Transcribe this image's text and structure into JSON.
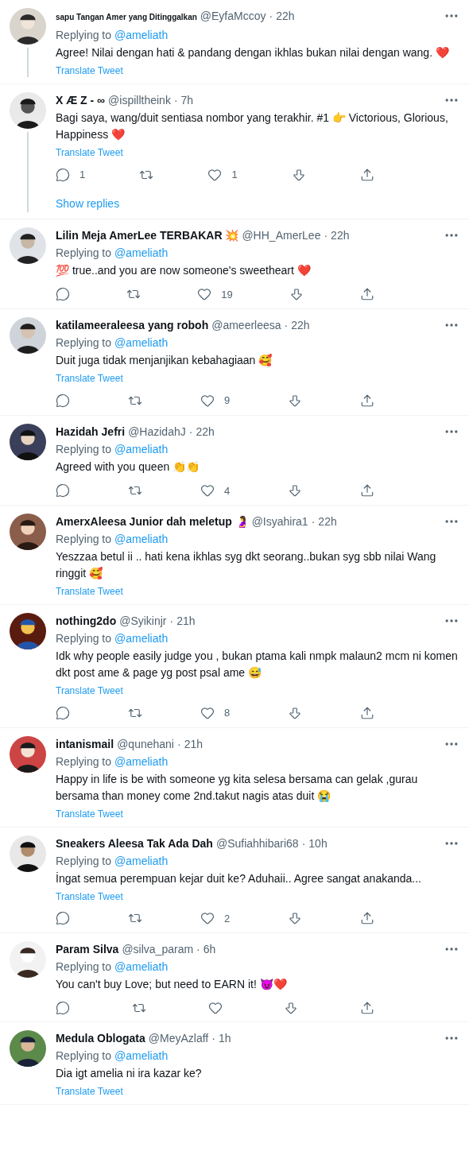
{
  "tweets": [
    {
      "name": "sapu Tangan Amer yang Ditinggalkan",
      "handle": "@EyfaMccoy",
      "separator": "·",
      "time": "22h",
      "replying_label": "Replying to",
      "replying_to": "@ameliath",
      "text": "Agree! Nilai dengan hati & pandang dengan ikhlas bukan nilai dengan wang. ❤️",
      "translate": "Translate Tweet",
      "thread": true,
      "actions": false
    },
    {
      "name": "X Æ Z - ∞",
      "handle": "@ispilltheink",
      "separator": "·",
      "time": "7h",
      "text": "Bagi saya, wang/duit sentiasa nombor yang terakhir. #1 👉 Victorious, Glorious, Happiness ❤️",
      "translate": "Translate Tweet",
      "actions": true,
      "reply_count": "1",
      "like_count": "1",
      "show_replies": "Show replies",
      "thread": true
    },
    {
      "name": "Lilin Meja AmerLee TERBAKAR 💥",
      "handle": "@HH_AmerLee",
      "separator": "·",
      "time": "22h",
      "replying_label": "Replying to",
      "replying_to": "@ameliath",
      "text": "💯 true..and you are now someone's sweetheart ❤️",
      "actions": true,
      "like_count": "19",
      "thread": false
    },
    {
      "name": "katilameeraleesa yang roboh",
      "handle": "@ameerleesa",
      "separator": "·",
      "time": "22h",
      "replying_label": "Replying to",
      "replying_to": "@ameliath",
      "text": "Duit juga tidak menjanjikan kebahagiaan 🥰",
      "translate": "Translate Tweet",
      "actions": true,
      "like_count": "9",
      "thread": false
    },
    {
      "name": "Hazidah Jefri",
      "handle": "@HazidahJ",
      "separator": "·",
      "time": "22h",
      "replying_label": "Replying to",
      "replying_to": "@ameliath",
      "text": "Agreed with you queen 👏👏",
      "actions": true,
      "like_count": "4",
      "thread": false
    },
    {
      "name": "AmerxAleesa Junior dah meletup 🤰",
      "handle": "@Isyahira1",
      "separator": "·",
      "time": "22h",
      "replying_label": "Replying to",
      "replying_to": "@ameliath",
      "text": "Yeszzaa betul ii .. hati kena ikhlas syg dkt seorang..bukan syg sbb nilai Wang ringgit 🥰",
      "translate": "Translate Tweet",
      "actions": false,
      "thread": false
    },
    {
      "name": "nothing2do",
      "handle": "@Syikinjr",
      "separator": "·",
      "time": "21h",
      "replying_label": "Replying to",
      "replying_to": "@ameliath",
      "text": "Idk why people easily judge you , bukan ptama kali nmpk malaun2 mcm ni komen dkt post ame & page yg post psal ame 😅",
      "translate": "Translate Tweet",
      "actions": true,
      "like_count": "8",
      "thread": false
    },
    {
      "name": "intanismail",
      "handle": "@qunehani",
      "separator": "·",
      "time": "21h",
      "replying_label": "Replying to",
      "replying_to": "@ameliath",
      "text": "Happy in life is be with someone yg kita selesa bersama can gelak ,gurau bersama than money come 2nd.takut nagis atas duit 😭",
      "translate": "Translate Tweet",
      "actions": false,
      "thread": false
    },
    {
      "name": "Sneakers Aleesa Tak Ada Dah",
      "handle": "@Sufiahhibari68",
      "separator": "·",
      "time": "10h",
      "replying_label": "Replying to",
      "replying_to": "@ameliath",
      "text": "İngat semua perempuan kejar duit ke? Aduhaii.. Agree sangat anakanda...",
      "translate": "Translate Tweet",
      "actions": true,
      "like_count": "2",
      "thread": false
    },
    {
      "name": "Param Silva",
      "handle": "@silva_param",
      "separator": "·",
      "time": "6h",
      "replying_label": "Replying to",
      "replying_to": "@ameliath",
      "text": "You can't buy Love; but need to EARN it! 😈❤️",
      "actions": true,
      "thread": false
    },
    {
      "name": "Medula Oblogata",
      "handle": "@MeyAzlaff",
      "separator": "·",
      "time": "1h",
      "replying_label": "Replying to",
      "replying_to": "@ameliath",
      "text": "Dia igt amelia ni ira kazar ke?",
      "translate": "Translate Tweet",
      "actions": false,
      "thread": false
    }
  ]
}
